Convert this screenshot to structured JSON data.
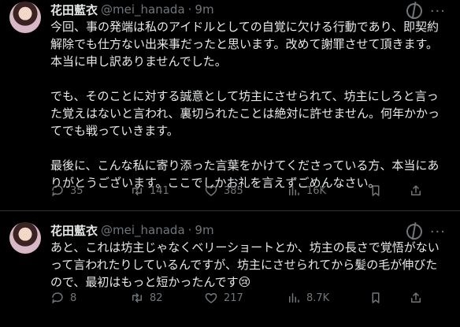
{
  "tweets": [
    {
      "name": "花田藍衣",
      "handle": "@mei_hanada",
      "time": "9m",
      "paragraphs": [
        "今回、事の発端は私のアイドルとしての自覚に欠ける行動であり、即契約解除でも仕方ない出来事だったと思います。改めて謝罪させて頂きます。本当に申し訳ありませんでした。",
        "でも、そのことに対する誠意として坊主にさせられて、坊主にしろと言った覚えはないと言われ、裏切られたことは絶対に許せません。何年かかってでも戦っていきます。",
        "最後に、こんな私に寄り添った言葉をかけてくださっている方、本当にありがとうございます。ここでしかお礼を言えずごめんなさい。"
      ],
      "stats": {
        "replies": "35",
        "retweets": "141",
        "likes": "385",
        "views": "16K"
      }
    },
    {
      "name": "花田藍衣",
      "handle": "@mei_hanada",
      "time": "9m",
      "paragraphs": [
        "あと、これは坊主じゃなくベリーショートとか、坊主の長さで覚悟がないって言われたりしているんですが、坊主にさせられてから髪の毛が伸びたので、最初はもっと短かったんです😢"
      ],
      "stats": {
        "replies": "8",
        "retweets": "82",
        "likes": "217",
        "views": "8.7K"
      }
    }
  ]
}
